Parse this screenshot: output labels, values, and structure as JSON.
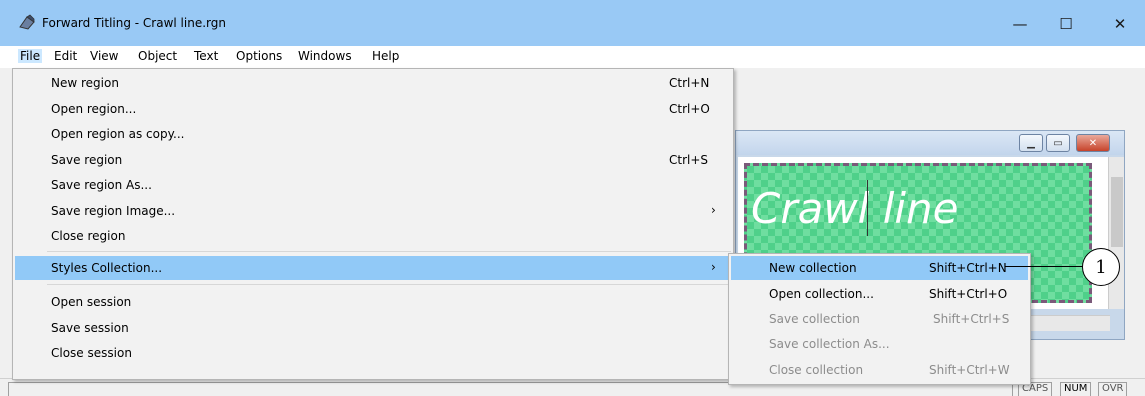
{
  "window": {
    "title": "Forward Titling - Crawl line.rgn",
    "minimize_glyph": "—",
    "maximize_glyph": "☐",
    "close_glyph": "✕"
  },
  "menubar": {
    "items": [
      {
        "label": "File"
      },
      {
        "label": "Edit"
      },
      {
        "label": "View"
      },
      {
        "label": "Object"
      },
      {
        "label": "Text"
      },
      {
        "label": "Options"
      },
      {
        "label": "Windows"
      },
      {
        "label": "Help"
      }
    ]
  },
  "file_menu": {
    "items": [
      {
        "label": "New region",
        "shortcut": "Ctrl+N"
      },
      {
        "label": "Open region...",
        "shortcut": "Ctrl+O"
      },
      {
        "label": "Open region as copy...",
        "shortcut": ""
      },
      {
        "label": "Save region",
        "shortcut": "Ctrl+S"
      },
      {
        "label": "Save region As...",
        "shortcut": ""
      },
      {
        "label": "Save region Image...",
        "shortcut": "",
        "submenu": true
      },
      {
        "label": "Close region",
        "shortcut": ""
      },
      {
        "label": "Styles Collection...",
        "shortcut": "",
        "submenu": true,
        "highlighted": true
      },
      {
        "label": "Open session",
        "shortcut": ""
      },
      {
        "label": "Save session",
        "shortcut": ""
      },
      {
        "label": "Close session",
        "shortcut": ""
      }
    ],
    "submenu_arrow": "›"
  },
  "styles_submenu": {
    "items": [
      {
        "label": "New collection",
        "shortcut": "Shift+Ctrl+N",
        "highlighted": true,
        "enabled": true
      },
      {
        "label": "Open collection...",
        "shortcut": "Shift+Ctrl+O",
        "enabled": true
      },
      {
        "label": "Save collection",
        "shortcut": "Shift+Ctrl+S",
        "enabled": false
      },
      {
        "label": "Save collection As...",
        "shortcut": "",
        "enabled": false
      },
      {
        "label": "Close collection",
        "shortcut": "Shift+Ctrl+W",
        "enabled": false
      }
    ]
  },
  "document": {
    "crawl_text": "Crawl line",
    "region_color": "#4fd08a"
  },
  "statusbar": {
    "caps": "CAPS",
    "num": "NUM",
    "ovr": "OVR"
  },
  "callout": {
    "number": "1"
  },
  "colors": {
    "titlebar": "#99c9f5",
    "menu_highlight": "#91c9f7"
  }
}
